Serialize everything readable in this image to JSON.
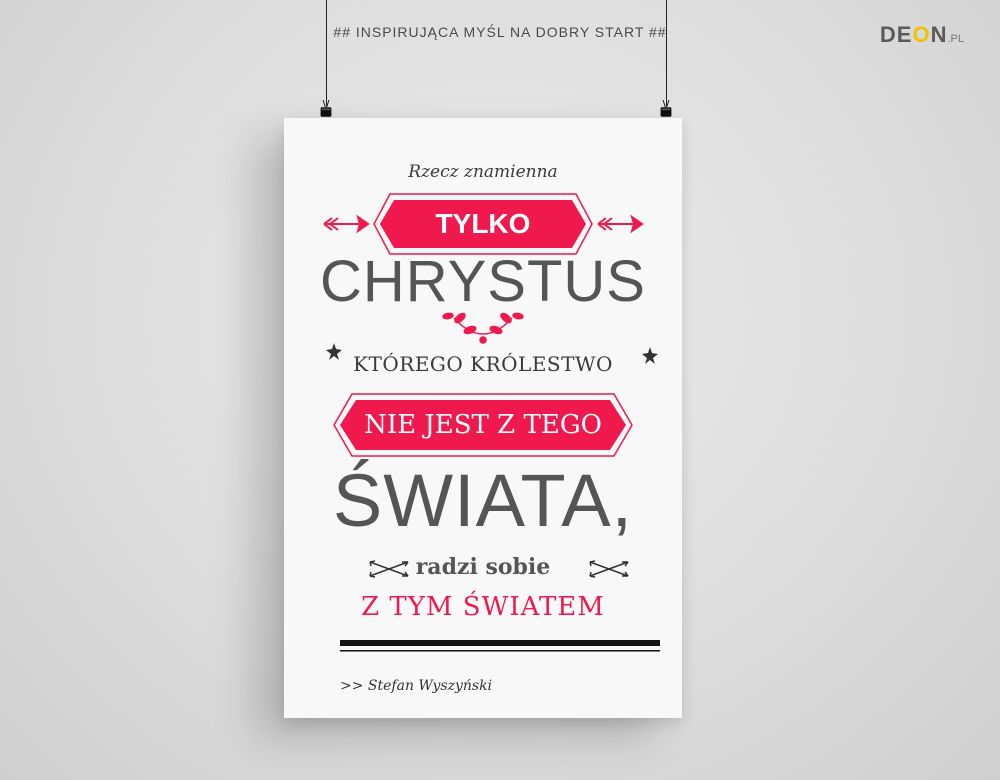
{
  "header": {
    "text": "## INSPIRUJĄCA MYŚL NA DOBRY START ##"
  },
  "logo": {
    "part1": "DE",
    "part2": "O",
    "part3": "N",
    "suffix": ".PL"
  },
  "poster": {
    "line1": "Rzecz znamienna",
    "banner1": "TYLKO",
    "line3": "CHRYSTUS",
    "line4": "KTÓREGO KRÓLESTWO",
    "banner2": "NIE JEST Z TEGO",
    "line6": "ŚWIATA,",
    "line7": "radzi sobie",
    "line8": "Z TYM ŚWIATEM",
    "author": ">> Stefan Wyszyński"
  },
  "colors": {
    "accent": "#f0194e",
    "text": "#555555",
    "background": "#dcdcdc"
  },
  "icons": [
    "arrow-left-icon",
    "arrow-right-icon",
    "laurel-icon",
    "star-icon",
    "crossed-arrows-icon",
    "binder-clip-icon"
  ]
}
